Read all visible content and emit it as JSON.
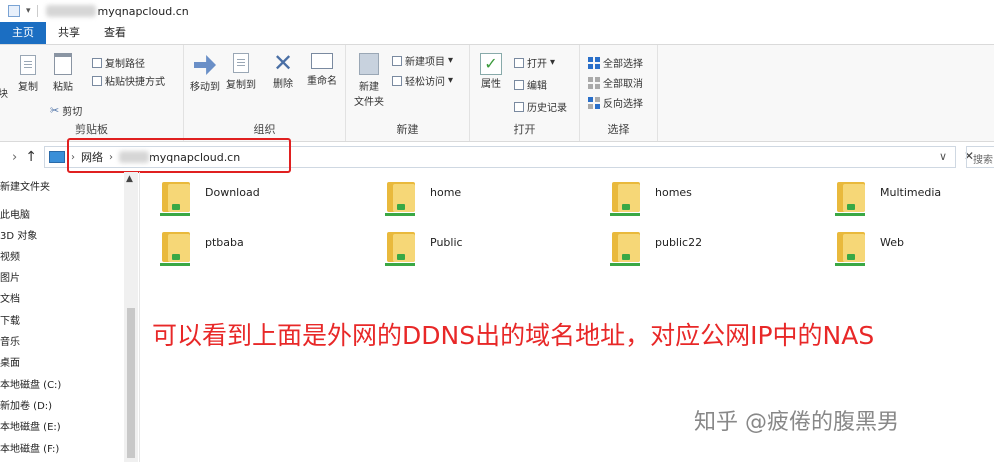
{
  "window": {
    "title": "myqnapcloud.cn"
  },
  "tabs": [
    {
      "label": "主页",
      "active": true
    },
    {
      "label": "共享",
      "active": false
    },
    {
      "label": "查看",
      "active": false
    }
  ],
  "ribbon": {
    "clipboard": {
      "label": "剪贴板",
      "cut_partial": "块",
      "copy": "复制",
      "paste": "粘贴",
      "copy_path": "复制路径",
      "paste_shortcut": "粘贴快捷方式",
      "cut": "剪切"
    },
    "organize": {
      "label": "组织",
      "move_to": "移动到",
      "copy_to": "复制到",
      "delete": "删除",
      "rename": "重命名"
    },
    "new": {
      "label": "新建",
      "new_folder_line1": "新建",
      "new_folder_line2": "文件夹",
      "new_item": "新建项目",
      "easy_access": "轻松访问"
    },
    "open": {
      "label": "打开",
      "properties": "属性",
      "open": "打开",
      "edit": "编辑",
      "history": "历史记录"
    },
    "select": {
      "label": "选择",
      "select_all": "全部选择",
      "select_none": "全部取消",
      "invert": "反向选择"
    }
  },
  "address": {
    "root": "网络",
    "host_suffix": "myqnapcloud.cn",
    "dropdown": "∨",
    "search_placeholder": "搜索"
  },
  "nav": {
    "items": [
      "新建文件夹",
      "此电脑",
      "3D 对象",
      "视频",
      "图片",
      "文档",
      "下载",
      "音乐",
      "桌面",
      "本地磁盘 (C:)",
      "新加卷 (D:)",
      "本地磁盘 (E:)",
      "本地磁盘 (F:)"
    ]
  },
  "folders": [
    "Download",
    "home",
    "homes",
    "Multimedia",
    "ptbaba",
    "Public",
    "public22",
    "Web"
  ],
  "annotation": "可以看到上面是外网的DDNS出的域名地址，对应公网IP中的NAS",
  "watermark": "知乎 @疲倦的腹黑男",
  "colors": {
    "accent": "#1b6ec2",
    "highlight": "#e02020",
    "annotation": "#e82828"
  }
}
